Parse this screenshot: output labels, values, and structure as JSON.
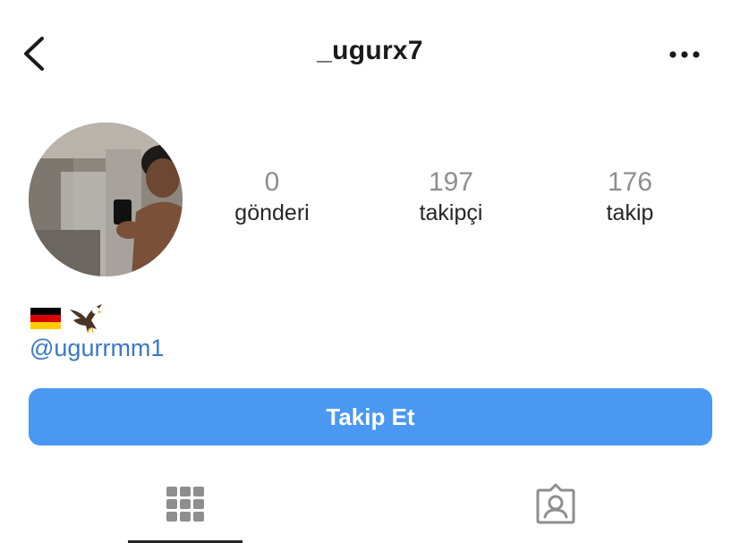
{
  "header": {
    "username": "_ugurx7",
    "back_icon": "chevron-left-icon",
    "more_icon": "more-horizontal-icon"
  },
  "profile": {
    "avatar": "profile-photo",
    "stats": {
      "posts": {
        "value": "0",
        "label": "gönderi"
      },
      "followers": {
        "value": "197",
        "label": "takipçi"
      },
      "following": {
        "value": "176",
        "label": "takip"
      }
    },
    "bio": {
      "emojis": [
        "german-flag-icon",
        "eagle-icon"
      ],
      "mention": "@ugurrmm1"
    }
  },
  "actions": {
    "follow_label": "Takip Et"
  },
  "tabs": [
    {
      "icon": "grid-icon",
      "active": true
    },
    {
      "icon": "tagged-person-icon",
      "active": false
    }
  ],
  "colors": {
    "primary_button": "#4a98f2",
    "link": "#3a78c6",
    "stat_value": "#8e8e8e",
    "text": "#262626"
  }
}
